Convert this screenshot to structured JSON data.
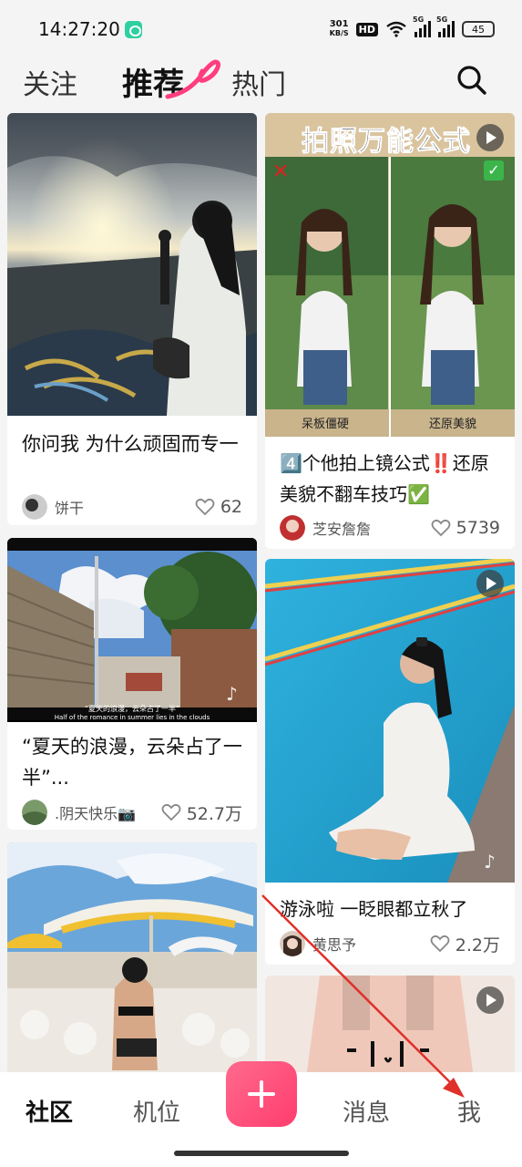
{
  "status_bar": {
    "time": "14:27:20",
    "net_speed_value": "301",
    "net_speed_unit": "KB/S",
    "hd_badge": "HD",
    "sim1_label": "5G",
    "sim2_label": "5G",
    "battery": "45"
  },
  "top_tabs": {
    "follow": "关注",
    "recommend": "推荐",
    "hot": "热门",
    "accent_color": "#ff3d7f"
  },
  "feed": {
    "cards": [
      {
        "title": "你问我 为什么顽固而专一",
        "author": "饼干",
        "likes": "62",
        "has_video": false
      },
      {
        "banner_text": "拍照万能公式",
        "left_caption": "呆板僵硬",
        "right_caption": "还原美貌",
        "title": "4️⃣个他拍上镜公式‼️还原美貌不翻车技巧✅",
        "author": "芝安詹詹",
        "likes": "5739",
        "has_video": true
      },
      {
        "image_caption_cn": "“夏天的浪漫，云朵占了一半”",
        "image_caption_en": "Half of the romance in summer lies in the clouds",
        "title": "“夏天的浪漫，云朵占了一半”...",
        "author": ".阴天快乐📷",
        "likes": "52.7万",
        "has_video": false
      },
      {
        "title": "游泳啦 一眨眼都立秋了",
        "author": "黄思予",
        "likes": "2.2万",
        "has_video": true
      },
      {
        "title": "",
        "author": "",
        "likes": "",
        "has_video": false
      },
      {
        "title": "",
        "author": "",
        "likes": "",
        "has_video": true
      }
    ]
  },
  "bottom_nav": {
    "community": "社区",
    "spot": "机位",
    "messages": "消息",
    "me": "我",
    "add_color": "#ff4d77"
  },
  "annotation": {
    "arrow_color": "#e0302a"
  }
}
